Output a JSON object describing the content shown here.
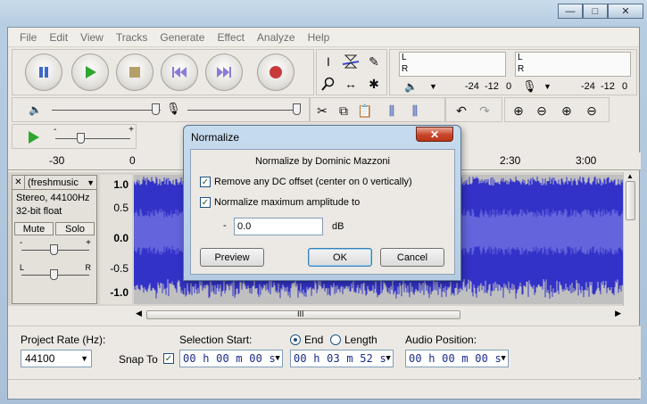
{
  "window": {
    "min_label": "▭",
    "max_label": "□",
    "close_label": "✕"
  },
  "menu": [
    "File",
    "Edit",
    "View",
    "Tracks",
    "Generate",
    "Effect",
    "Analyze",
    "Help"
  ],
  "meters": {
    "play_scale": [
      "-24",
      "-12",
      "0"
    ],
    "rec_scale": [
      "-24",
      "-12",
      "0"
    ],
    "left": "L",
    "right": "R"
  },
  "ruler": {
    "labels": [
      "-30",
      "0",
      "2:30",
      "3:00"
    ]
  },
  "track": {
    "close": "✕",
    "name": "(freshmusic",
    "format": "Stereo, 44100Hz",
    "bits": "32-bit float",
    "mute": "Mute",
    "solo": "Solo",
    "gain_minus": "-",
    "gain_plus": "+",
    "pan_left": "L",
    "pan_right": "R",
    "scale": [
      "1.0",
      "0.5",
      "0.0",
      "-0.5",
      "-1.0"
    ],
    "colors": {
      "wave": "#3232c8",
      "wave_light": "#6464dc",
      "background": "#c0c0c0"
    }
  },
  "selection_bar": {
    "project_rate_label": "Project Rate (Hz):",
    "project_rate": "44100",
    "snap_to_label": "Snap To",
    "selection_start_label": "Selection Start:",
    "end_label": "End",
    "length_label": "Length",
    "audio_position_label": "Audio Position:",
    "start_time": "00 h 00 m 00 s",
    "end_time": "00 h 03 m 52 s",
    "audio_position": "00 h 00 m 00 s"
  },
  "dialog": {
    "title": "Normalize",
    "heading": "Normalize by Dominic Mazzoni",
    "option_dc": "Remove any DC offset (center on 0 vertically)",
    "option_amp": "Normalize maximum amplitude to",
    "minus": "-",
    "amplitude_value": "0.0",
    "unit": "dB",
    "preview": "Preview",
    "ok": "OK",
    "cancel": "Cancel",
    "close": "✕"
  },
  "scroll": {
    "grip": "III"
  }
}
